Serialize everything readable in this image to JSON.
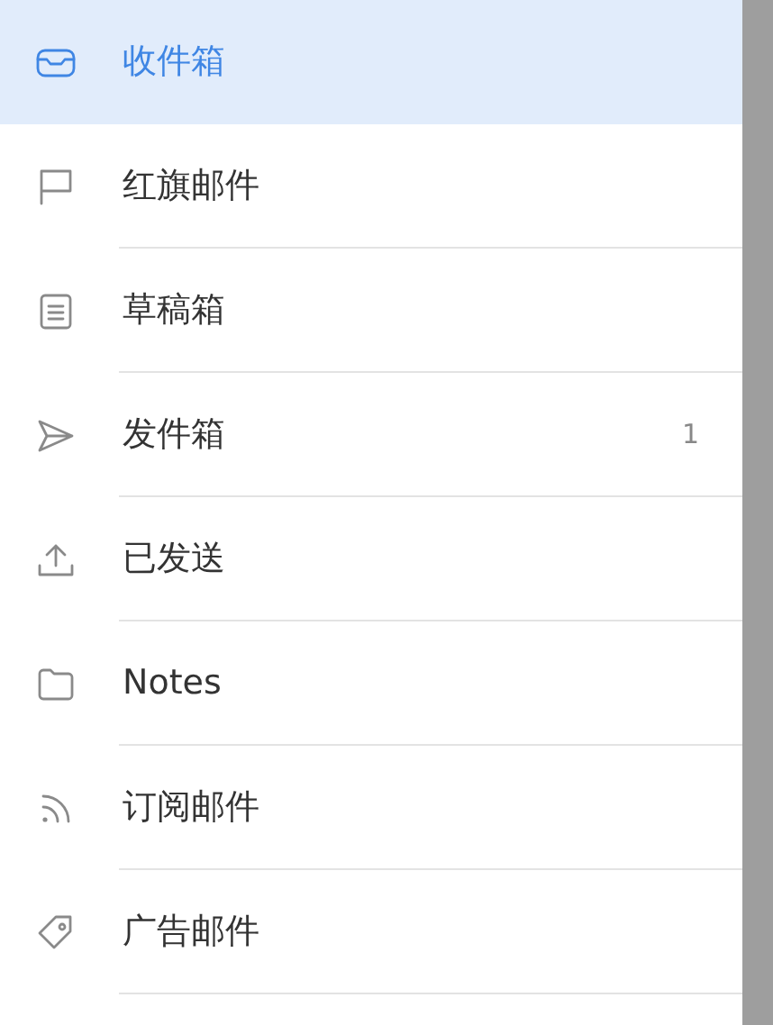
{
  "folders": [
    {
      "label": "收件箱",
      "selected": true
    },
    {
      "label": "红旗邮件",
      "selected": false
    },
    {
      "label": "草稿箱",
      "selected": false
    },
    {
      "label": "发件箱",
      "selected": false,
      "count": "1"
    },
    {
      "label": "已发送",
      "selected": false
    },
    {
      "label": "Notes",
      "selected": false
    },
    {
      "label": "订阅邮件",
      "selected": false
    },
    {
      "label": "广告邮件",
      "selected": false
    }
  ]
}
